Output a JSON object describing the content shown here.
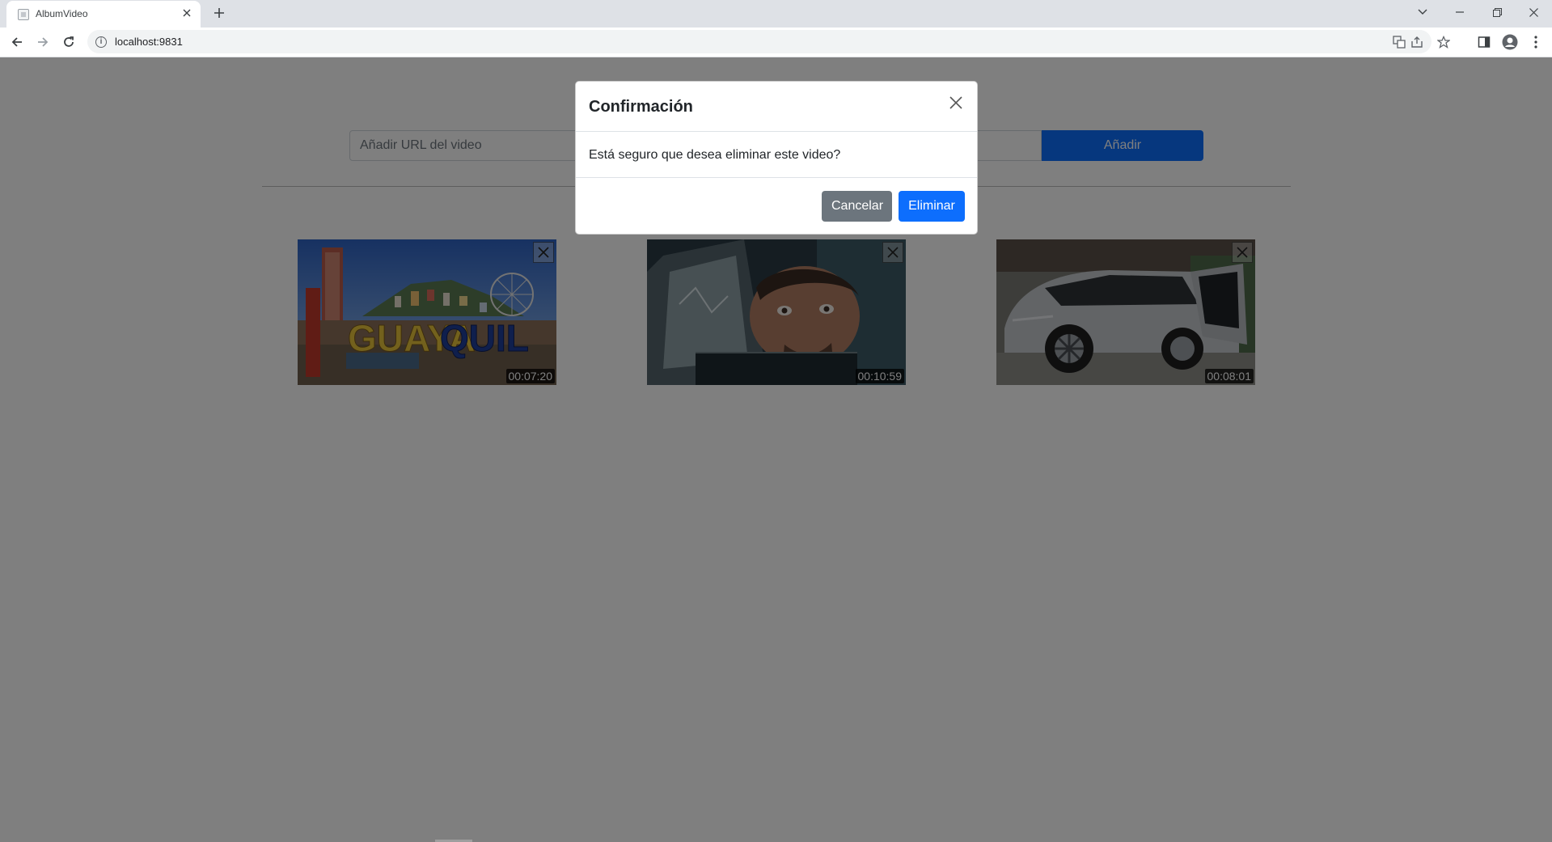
{
  "browser": {
    "tab_title": "AlbumVideo",
    "url": "localhost:9831",
    "icons": [
      "tab-favicon",
      "close-icon",
      "plus-icon",
      "chevron-down-icon",
      "minimize-icon",
      "restore-icon",
      "close-window-icon",
      "back-arrow-icon",
      "forward-arrow-icon",
      "reload-icon",
      "info-icon",
      "translate-icon",
      "share-icon",
      "star-icon",
      "sidepanel-icon",
      "profile-icon",
      "more-vert-icon"
    ]
  },
  "add_form": {
    "placeholder": "Añadir URL del video",
    "button_label": "Añadir"
  },
  "videos": [
    {
      "thumbnail_text_yellow": "GUAYA",
      "thumbnail_text_blue": "QUIL",
      "duration": "00:07:20"
    },
    {
      "duration": "00:10:59"
    },
    {
      "duration": "00:08:01"
    }
  ],
  "modal": {
    "title": "Confirmación",
    "message": "Está seguro que desea eliminar este video?",
    "cancel_label": "Cancelar",
    "confirm_label": "Eliminar"
  },
  "colors": {
    "primary": "#0d6efd",
    "secondary": "#6c757d",
    "backdrop": "rgba(0,0,0,0.5)"
  }
}
